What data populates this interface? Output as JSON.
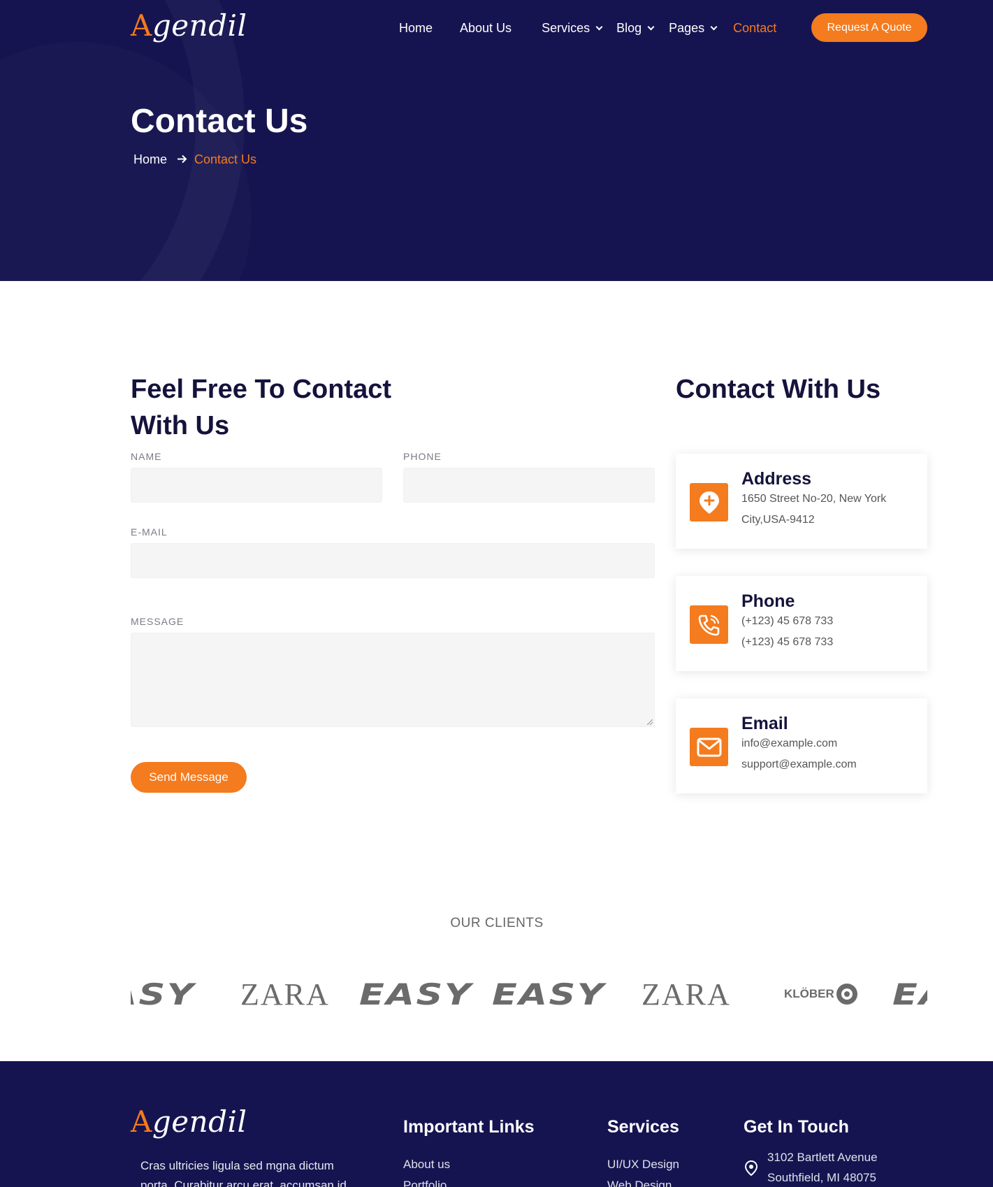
{
  "brand": {
    "logo_initial": "A",
    "logo_rest": "gendil"
  },
  "nav": {
    "items": [
      {
        "label": "Home",
        "has_dropdown": false
      },
      {
        "label": "About Us",
        "has_dropdown": false
      },
      {
        "label": "Services",
        "has_dropdown": true
      },
      {
        "label": "Blog",
        "has_dropdown": true
      },
      {
        "label": "Pages",
        "has_dropdown": true
      },
      {
        "label": "Contact",
        "has_dropdown": false,
        "active": true
      }
    ],
    "cta_label": "Request A Quote"
  },
  "hero": {
    "title": "Contact Us",
    "breadcrumb": {
      "home": "Home",
      "current": "Contact Us"
    }
  },
  "form": {
    "heading_line1": "Feel Free To Contact",
    "heading_line2": "With Us",
    "name_label": "NAME",
    "phone_label": "PHONE",
    "email_label": "E-MAIL",
    "message_label": "MESSAGE",
    "name_value": "",
    "phone_value": "",
    "email_value": "",
    "message_value": "",
    "submit_label": "Send Message"
  },
  "contact_info": {
    "heading": "Contact With Us",
    "cards": [
      {
        "icon": "map-pin-plus-icon",
        "title": "Address",
        "line1": "1650 Street No-20, New York",
        "line2": "City,USA-9412"
      },
      {
        "icon": "phone-icon",
        "title": "Phone",
        "line1": "(+123) 45 678 733",
        "line2": "(+123) 45 678 733"
      },
      {
        "icon": "envelope-icon",
        "title": "Email",
        "line1": "info@example.com",
        "line2": "support@example.com"
      }
    ]
  },
  "clients": {
    "title": "OUR CLIENTS",
    "logos": [
      "EASY",
      "ZARA",
      "EASY",
      "EASY",
      "ZARA",
      "KLÖBER",
      "EASY"
    ]
  },
  "footer": {
    "about_text": "Cras ultricies ligula sed mgna dictum porta. Curabitur arcu erat, accumsan id",
    "important_links": {
      "heading": "Important Links",
      "items": [
        "About us",
        "Portfolio"
      ]
    },
    "services": {
      "heading": "Services",
      "items": [
        "UI/UX Design",
        "Web Design"
      ]
    },
    "get_in_touch": {
      "heading": "Get In Touch",
      "address_line1": "3102 Bartlett Avenue",
      "address_line2": "Southfield, MI 48075"
    }
  },
  "colors": {
    "primary_dark": "#161450",
    "accent": "#f47b1e",
    "text_dark": "#14133b",
    "input_bg": "#f5f5f5"
  }
}
